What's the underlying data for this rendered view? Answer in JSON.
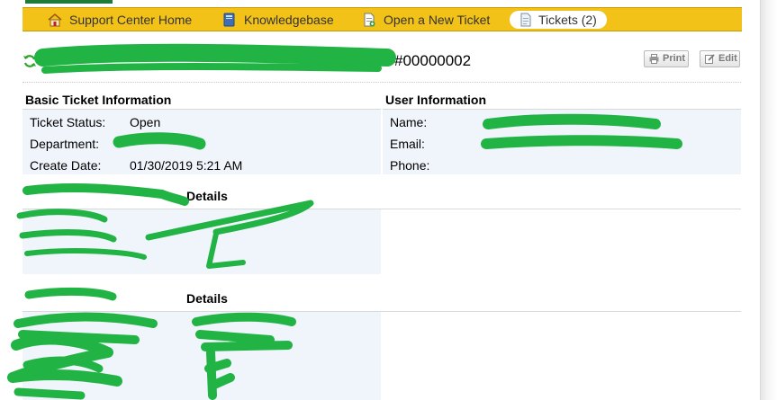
{
  "nav": {
    "items": [
      {
        "label": "Support Center Home",
        "icon": "home-icon"
      },
      {
        "label": "Knowledgebase",
        "icon": "book-icon"
      },
      {
        "label": "Open a New Ticket",
        "icon": "new-ticket-icon"
      },
      {
        "label": "Tickets (2)",
        "icon": "ticket-icon",
        "active": true
      }
    ]
  },
  "ticket": {
    "name_redacted": "",
    "number": "#00000002"
  },
  "actions": {
    "print_label": "Print",
    "edit_label": "Edit"
  },
  "basic_info": {
    "heading": "Basic Ticket Information",
    "fields": [
      {
        "label": "Ticket Status:",
        "value": "Open"
      },
      {
        "label": "Department:",
        "value": ""
      },
      {
        "label": "Create Date:",
        "value": "01/30/2019 5:21 AM"
      }
    ]
  },
  "user_info": {
    "heading": "User Information",
    "fields": [
      {
        "label": "Name:",
        "value": ""
      },
      {
        "label": "Email:",
        "value": ""
      },
      {
        "label": "Phone:",
        "value": ""
      }
    ]
  },
  "section2": {
    "heading_suffix": "Details"
  },
  "section3": {
    "heading_suffix": "Details"
  },
  "colors": {
    "nav_bg": "#f3c219",
    "brand_green": "#1d7a37",
    "redaction": "#22b345",
    "info_box_bg": "#f0f5fc"
  }
}
